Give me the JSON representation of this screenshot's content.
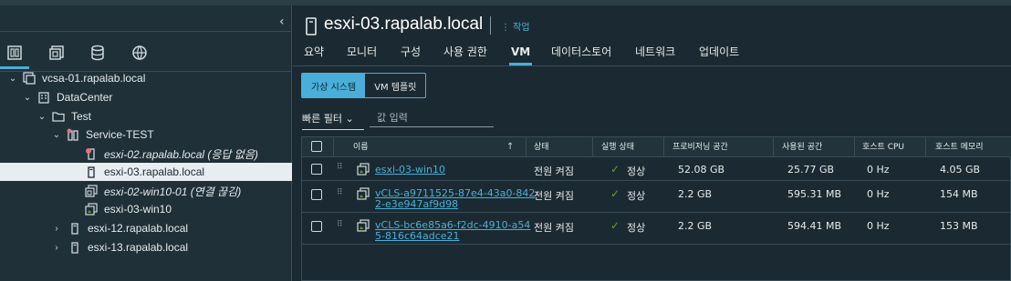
{
  "sidebar": {
    "collapse_glyph": "‹",
    "nav_icons": [
      "hosts-clusters-icon",
      "vms-templates-icon",
      "storage-icon",
      "networking-icon"
    ],
    "tree": [
      {
        "label": "vcsa-01.rapalab.local",
        "icon": "vcenter-icon",
        "chevron": "⌄"
      },
      {
        "label": "DataCenter",
        "icon": "datacenter-icon",
        "chevron": "⌄"
      },
      {
        "label": "Test",
        "icon": "folder-icon",
        "chevron": "⌄"
      },
      {
        "label": "Service-TEST",
        "icon": "cluster-icon",
        "chevron": "⌄"
      },
      {
        "label": "esxi-02.rapalab.local (응답 없음)",
        "icon": "host-alert-icon",
        "chevron": ""
      },
      {
        "label": "esxi-03.rapalab.local",
        "icon": "host-icon",
        "chevron": ""
      },
      {
        "label": "esxi-02-win10-01 (연결 끊김)",
        "icon": "vm-icon",
        "chevron": ""
      },
      {
        "label": "esxi-03-win10",
        "icon": "vm-icon",
        "chevron": ""
      },
      {
        "label": "esxi-12.rapalab.local",
        "icon": "host-icon",
        "chevron": "›"
      },
      {
        "label": "esxi-13.rapalab.local",
        "icon": "host-icon",
        "chevron": "›"
      }
    ]
  },
  "header": {
    "title": "esxi-03.rapalab.local",
    "actions_label": "⋮ 작업"
  },
  "tabs": [
    "요약",
    "모니터",
    "구성",
    "사용 권한",
    "VM",
    "데이터스토어",
    "네트워크",
    "업데이트"
  ],
  "active_tab": "VM",
  "segment": {
    "options": [
      "가상 시스템",
      "VM 템플릿"
    ],
    "selected": "가상 시스템"
  },
  "filter": {
    "label": "빠른 필터 ⌄",
    "placeholder": "값 입력"
  },
  "table": {
    "columns": [
      "이름",
      "상태",
      "실행 상태",
      "프로비저닝 공간",
      "사용된 공간",
      "호스트 CPU",
      "호스트 메모리"
    ],
    "sort_glyph": "↑",
    "rows": [
      {
        "name": "esxi-03-win10",
        "name_line2": "",
        "state": "전원 켜짐",
        "run_state": "정상",
        "provisioned": "52.08 GB",
        "used": "25.77 GB",
        "cpu": "0 Hz",
        "mem": "4.05 GB"
      },
      {
        "name": "vCLS-a9711525-87e4-43a0-842",
        "name_line2": "2-e3e947af9d98",
        "state": "전원 켜짐",
        "run_state": "정상",
        "provisioned": "2.2 GB",
        "used": "595.31 MB",
        "cpu": "0 Hz",
        "mem": "154 MB"
      },
      {
        "name": "vCLS-bc6e85a6-f2dc-4910-a54",
        "name_line2": "5-816c64adce21",
        "state": "전원 켜짐",
        "run_state": "정상",
        "provisioned": "2.2 GB",
        "used": "594.41 MB",
        "cpu": "0 Hz",
        "mem": "153 MB"
      }
    ]
  },
  "colors": {
    "accent": "#49afd9",
    "ok": "#62a420",
    "alert": "#e57373"
  }
}
